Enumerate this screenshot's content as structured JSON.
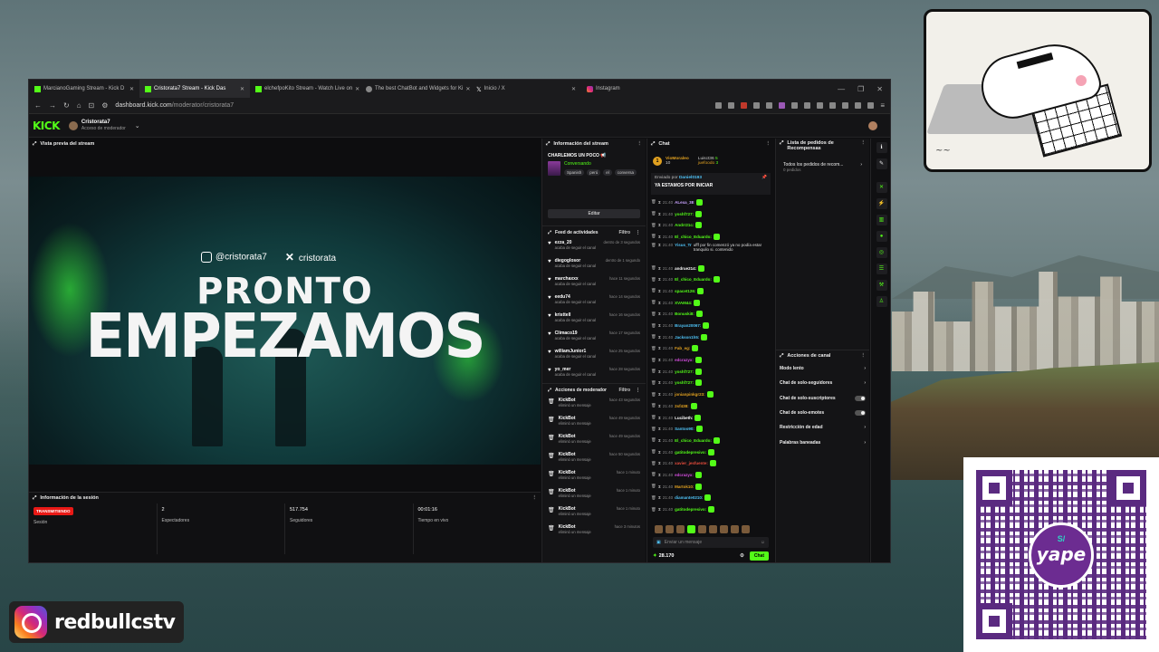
{
  "browser": {
    "tabs": [
      {
        "label": "MarcianoGaming Stream - Kick D",
        "active": false,
        "icon": "kick-icon"
      },
      {
        "label": "Cristorata7 Stream - Kick Das",
        "active": true,
        "icon": "kick-icon"
      },
      {
        "label": "elchefpoKito Stream - Watch Live on",
        "active": false,
        "icon": "kick-icon"
      },
      {
        "label": "The best ChatBot and Widgets for Ki",
        "active": false,
        "icon": "bot-icon"
      },
      {
        "label": "Inicio / X",
        "active": false,
        "icon": "x-icon"
      },
      {
        "label": "Instagram",
        "active": false,
        "icon": "instagram-icon"
      }
    ],
    "url_host": "dashboard.kick.com",
    "url_path": "/moderator/cristorata7"
  },
  "kick": {
    "logo": "KICK",
    "channel_name": "Cristorata7",
    "channel_role": "Acceso de moderador"
  },
  "preview": {
    "title": "Vista previa del stream",
    "instagram_handle": "@cristorata7",
    "x_handle": "cristorata",
    "headline_1": "PRONTO",
    "headline_2": "EMPEZAMOS"
  },
  "session": {
    "title": "Información de la sesión",
    "cells": [
      {
        "value": "TRANSMITIENDO",
        "label": "Sesión",
        "badge": true
      },
      {
        "value": "2",
        "label": "Espectadores"
      },
      {
        "value": "517.754",
        "label": "Seguidores"
      },
      {
        "value": "00:01:16",
        "label": "Tiempo en vivo"
      }
    ]
  },
  "stream_info": {
    "title": "Información del stream",
    "stream_title": "CHARLEMOS UN POCO",
    "category": "Conversando",
    "tags": [
      "Spanish",
      "perú",
      "el",
      "conversa"
    ],
    "edit_label": "Editar"
  },
  "activity": {
    "title": "Feed de actividades",
    "filter": "Filtro",
    "items": [
      {
        "name": "ezza_20",
        "desc": "acaba de seguir el canal",
        "time": "dentro de 3 segundos"
      },
      {
        "name": "diegoglosor",
        "desc": "acaba de seguir el canal",
        "time": "dentro de 1 segundo"
      },
      {
        "name": "marchaxxx",
        "desc": "acaba de seguir el canal",
        "time": "hace 11 segundos"
      },
      {
        "name": "eedu74",
        "desc": "acaba de seguir el canal",
        "time": "hace 14 segundos"
      },
      {
        "name": "kristtell",
        "desc": "acaba de seguir el canal",
        "time": "hace 16 segundos"
      },
      {
        "name": "Climaco19",
        "desc": "acaba de seguir el canal",
        "time": "hace 17 segundos"
      },
      {
        "name": "williamJunior1",
        "desc": "acaba de seguir el canal",
        "time": "hace 25 segundos"
      },
      {
        "name": "yo_mer",
        "desc": "acaba de seguir el canal",
        "time": "hace 28 segundos"
      }
    ]
  },
  "mod_actions": {
    "title": "Acciones de moderador",
    "filter": "Filtro",
    "items": [
      {
        "name": "KickBot",
        "desc": "eliminó un mensaje",
        "time": "hace 43 segundos"
      },
      {
        "name": "KickBot",
        "desc": "eliminó un mensaje",
        "time": "hace 49 segundos"
      },
      {
        "name": "KickBot",
        "desc": "eliminó un mensaje",
        "time": "hace 49 segundos"
      },
      {
        "name": "KickBot",
        "desc": "eliminó un mensaje",
        "time": "hace 50 segundos"
      },
      {
        "name": "KickBot",
        "desc": "eliminó un mensaje",
        "time": "hace 1 minuto"
      },
      {
        "name": "KickBot",
        "desc": "eliminó un mensaje",
        "time": "hace 1 minuto"
      },
      {
        "name": "KickBot",
        "desc": "eliminó un mensaje",
        "time": "hace 1 minuto"
      },
      {
        "name": "KickBot",
        "desc": "eliminó un mensaje",
        "time": "hace 3 minutos"
      }
    ]
  },
  "chat": {
    "title": "Chat",
    "top_gifter_1": "VioMoraleo",
    "top_gifter_1_count": "10",
    "top_gifter_2": "Luisct36",
    "top_gifter_2_count": "5",
    "top_gifter_3": "juefoodo",
    "top_gifter_3_count": "3",
    "pinned_by": "Enviado por",
    "pinned_user": "Daniel0193",
    "pinned_msg": "YA ESTAMOS POR INICIAR",
    "lines": [
      {
        "time": "21:40",
        "user": "ALexa_3E",
        "color": "#c9a3ff",
        "msg": ""
      },
      {
        "time": "21:40",
        "user": "yoshf727:",
        "color": "#53fc18",
        "msg": ""
      },
      {
        "time": "21:40",
        "user": "Andrr21c:",
        "color": "#53fc18",
        "msg": ""
      },
      {
        "time": "21:40",
        "user": "El_chico_Eduardo:",
        "color": "#53fc18",
        "msg": ""
      },
      {
        "time": "21:40",
        "user": "Yisus_Tr",
        "color": "#4fc3f7",
        "msg": "ufff por fin comenzó ya no podía estar tranquilo si. contenido"
      },
      {
        "time": "21:40",
        "user": "andrue214:",
        "color": "#fff",
        "msg": ""
      },
      {
        "time": "21:40",
        "user": "El_chico_Eduardo:",
        "color": "#53fc18",
        "msg": ""
      },
      {
        "time": "21:40",
        "user": "spacet126:",
        "color": "#53fc18",
        "msg": ""
      },
      {
        "time": "21:40",
        "user": "XVAM44:",
        "color": "#53fc18",
        "msg": ""
      },
      {
        "time": "21:40",
        "user": "Bonuski8:",
        "color": "#53fc18",
        "msg": ""
      },
      {
        "time": "21:40",
        "user": "Brayan20067:",
        "color": "#4fc3f7",
        "msg": ""
      },
      {
        "time": "21:40",
        "user": "Jackson1h5:",
        "color": "#4fc3f7",
        "msg": ""
      },
      {
        "time": "21:40",
        "user": "Fab_eg:",
        "color": "#e0a020",
        "msg": ""
      },
      {
        "time": "21:40",
        "user": "edcrazyx:",
        "color": "#d64ee0",
        "msg": ""
      },
      {
        "time": "21:40",
        "user": "yoshf727:",
        "color": "#53fc18",
        "msg": ""
      },
      {
        "time": "21:40",
        "user": "yoshf727:",
        "color": "#53fc18",
        "msg": ""
      },
      {
        "time": "21:40",
        "user": "jonianpinkgr23:",
        "color": "#e0a020",
        "msg": ""
      },
      {
        "time": "21:40",
        "user": "2sf438:",
        "color": "#e0a020",
        "msg": ""
      },
      {
        "time": "21:40",
        "user": "Lucibeth:",
        "color": "#fff",
        "msg": ""
      },
      {
        "time": "21:40",
        "user": "Santoo90:",
        "color": "#4fc3f7",
        "msg": ""
      },
      {
        "time": "21:40",
        "user": "El_chico_Eduardo:",
        "color": "#53fc18",
        "msg": ""
      },
      {
        "time": "21:40",
        "user": "gatitodepresivo:",
        "color": "#53fc18",
        "msg": ""
      },
      {
        "time": "21:40",
        "user": "xavier_jesfuente:",
        "color": "#e74c3c",
        "msg": ""
      },
      {
        "time": "21:40",
        "user": "edcrazyx:",
        "color": "#d64ee0",
        "msg": ""
      },
      {
        "time": "21:40",
        "user": "Martok10:",
        "color": "#e0a020",
        "msg": ""
      },
      {
        "time": "21:40",
        "user": "diamante0210:",
        "color": "#4fc3f7",
        "msg": ""
      },
      {
        "time": "21:40",
        "user": "gatitodepresivo:",
        "color": "#53fc18",
        "msg": ""
      }
    ],
    "input_placeholder": "Enviar un mensaje",
    "points": "28.170",
    "send_label": "Chat"
  },
  "rewards": {
    "title": "Lista de pedidos de Recompensas",
    "item": "Todos los pedidos de recom...",
    "item_sub": "0 pedidos"
  },
  "channel_actions": {
    "title": "Acciones de canal",
    "items": [
      {
        "label": "Modo lento",
        "type": "arrow"
      },
      {
        "label": "Chat de solo-seguidores",
        "type": "arrow"
      },
      {
        "label": "Chat de solo-suscriptores",
        "type": "toggle"
      },
      {
        "label": "Chat de solo-emotes",
        "type": "toggle"
      },
      {
        "label": "Restricción de edad",
        "type": "arrow"
      },
      {
        "label": "Palabras baneadas",
        "type": "arrow"
      }
    ]
  },
  "overlay": {
    "instagram_handle": "redbullcstv",
    "yape_label": "yape",
    "yape_symbol": "S/"
  },
  "colors": {
    "kick_green": "#53fc18",
    "live_red": "#e91916",
    "yape_purple": "#6c2c91"
  }
}
